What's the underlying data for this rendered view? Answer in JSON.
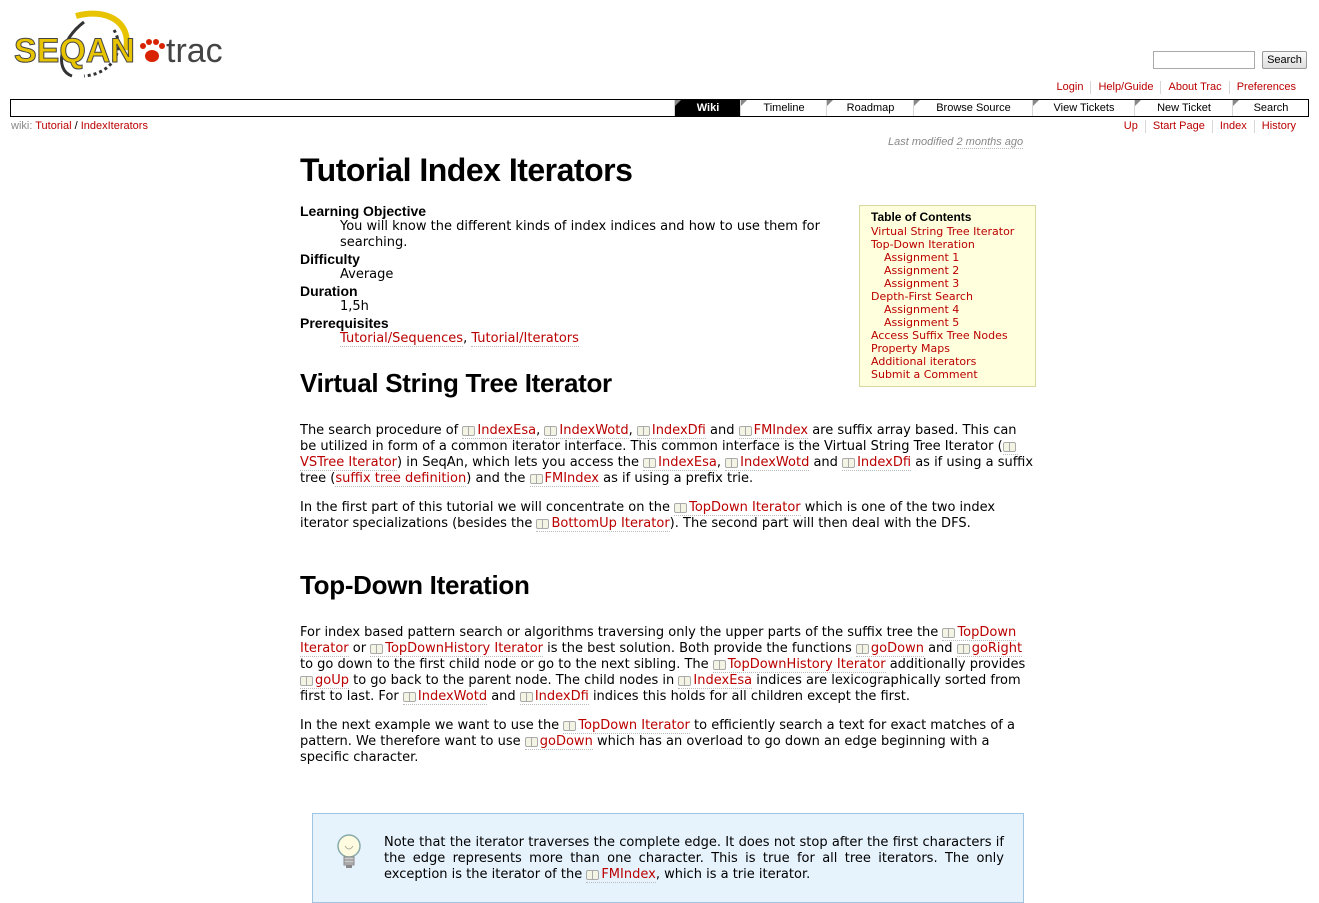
{
  "logo": {
    "text_seqan": "SEQAN",
    "text_trac": "trac"
  },
  "search": {
    "placeholder": "",
    "button_label": "Search"
  },
  "metanav": {
    "items": [
      "Login",
      "Help/Guide",
      "About Trac",
      "Preferences"
    ]
  },
  "mainnav": {
    "tabs": [
      "Wiki",
      "Timeline",
      "Roadmap",
      "Browse Source",
      "View Tickets",
      "New Ticket",
      "Search"
    ],
    "active": "Wiki"
  },
  "ctxnav": {
    "path_prefix": "wiki:",
    "path": [
      "Tutorial",
      "IndexIterators"
    ],
    "links": [
      "Up",
      "Start Page",
      "Index",
      "History"
    ]
  },
  "lastmod": {
    "prefix": "Last modified",
    "ago": "2 months ago"
  },
  "page": {
    "title": "Tutorial Index Iterators"
  },
  "info": {
    "learning_label": "Learning Objective",
    "learning_value": "You will know the different kinds of index indices and how to use them for searching.",
    "difficulty_label": "Difficulty",
    "difficulty_value": "Average",
    "duration_label": "Duration",
    "duration_value": "1,5h",
    "prereq_label": "Prerequisites",
    "prereq_links": [
      "Tutorial/Sequences",
      "Tutorial/Iterators"
    ]
  },
  "toc": {
    "title": "Table of Contents",
    "items": [
      {
        "label": "Virtual String Tree Iterator",
        "level": 1
      },
      {
        "label": "Top-Down Iteration",
        "level": 1
      },
      {
        "label": "Assignment 1",
        "level": 2
      },
      {
        "label": "Assignment 2",
        "level": 2
      },
      {
        "label": "Assignment 3",
        "level": 2
      },
      {
        "label": "Depth-First Search",
        "level": 1
      },
      {
        "label": "Assignment 4",
        "level": 2
      },
      {
        "label": "Assignment 5",
        "level": 2
      },
      {
        "label": "Access Suffix Tree Nodes",
        "level": 1
      },
      {
        "label": "Property Maps",
        "level": 1
      },
      {
        "label": "Additional iterators",
        "level": 1
      },
      {
        "label": "Submit a Comment",
        "level": 1
      }
    ]
  },
  "section1": {
    "heading": "Virtual String Tree Iterator",
    "p1": {
      "t1": "The search procedure of ",
      "l1": "IndexEsa",
      "t2": ", ",
      "l2": "IndexWotd",
      "t3": ", ",
      "l3": "IndexDfi",
      "t4": " and ",
      "l4": "FMIndex",
      "t5": " are suffix array based. This can be utilized in form of a common iterator interface. This common interface is the Virtual String Tree Iterator (",
      "l5": "VSTree Iterator",
      "t6": ") in SeqAn, which lets you access the ",
      "l6": "IndexEsa",
      "t7": ", ",
      "l7": "IndexWotd",
      "t8": " and ",
      "l8": "IndexDfi",
      "t9": " as if using a suffix tree (",
      "l9": "suffix tree definition",
      "t10": ") and the ",
      "l10": "FMIndex",
      "t11": " as if using a prefix trie."
    },
    "p2": {
      "t1": "In the first part of this tutorial we will concentrate on the ",
      "l1": "TopDown Iterator",
      "t2": " which is one of the two index iterator specializations (besides the ",
      "l2": "BottomUp Iterator",
      "t3": "). The second part will then deal with the DFS."
    }
  },
  "section2": {
    "heading": "Top-Down Iteration",
    "p1": {
      "t1": "For index based pattern search or algorithms traversing only the upper parts of the suffix tree the ",
      "l1": "TopDown Iterator",
      "t2": " or ",
      "l2": "TopDownHistory Iterator",
      "t3": " is the best solution. Both provide the functions ",
      "l3": "goDown",
      "t4": " and ",
      "l4": "goRight",
      "t5": " to go down to the first child node or go to the next sibling. The ",
      "l5": "TopDownHistory Iterator",
      "t6": " additionally provides ",
      "l6": "goUp",
      "t7": " to go back to the parent node. The child nodes in ",
      "l7": "IndexEsa",
      "t8": " indices are lexicographically sorted from first to last. For ",
      "l8": "IndexWotd",
      "t9": " and ",
      "l9": "IndexDfi",
      "t10": " indices this holds for all children except the first."
    },
    "p2": {
      "t1": "In the next example we want to use the ",
      "l1": "TopDown Iterator",
      "t2": " to efficiently search a text for exact matches of a pattern. We therefore want to use ",
      "l2": "goDown",
      "t3": " which has an overload to go down an edge beginning with a specific character."
    }
  },
  "note": {
    "t1": "Note that the iterator traverses the complete edge. It does not stop after the first characters if the edge represents more than one character. This is true for all tree iterators. The only exception is the iterator of the ",
    "l1": "FMIndex",
    "t2": ", which is a trie iterator."
  }
}
